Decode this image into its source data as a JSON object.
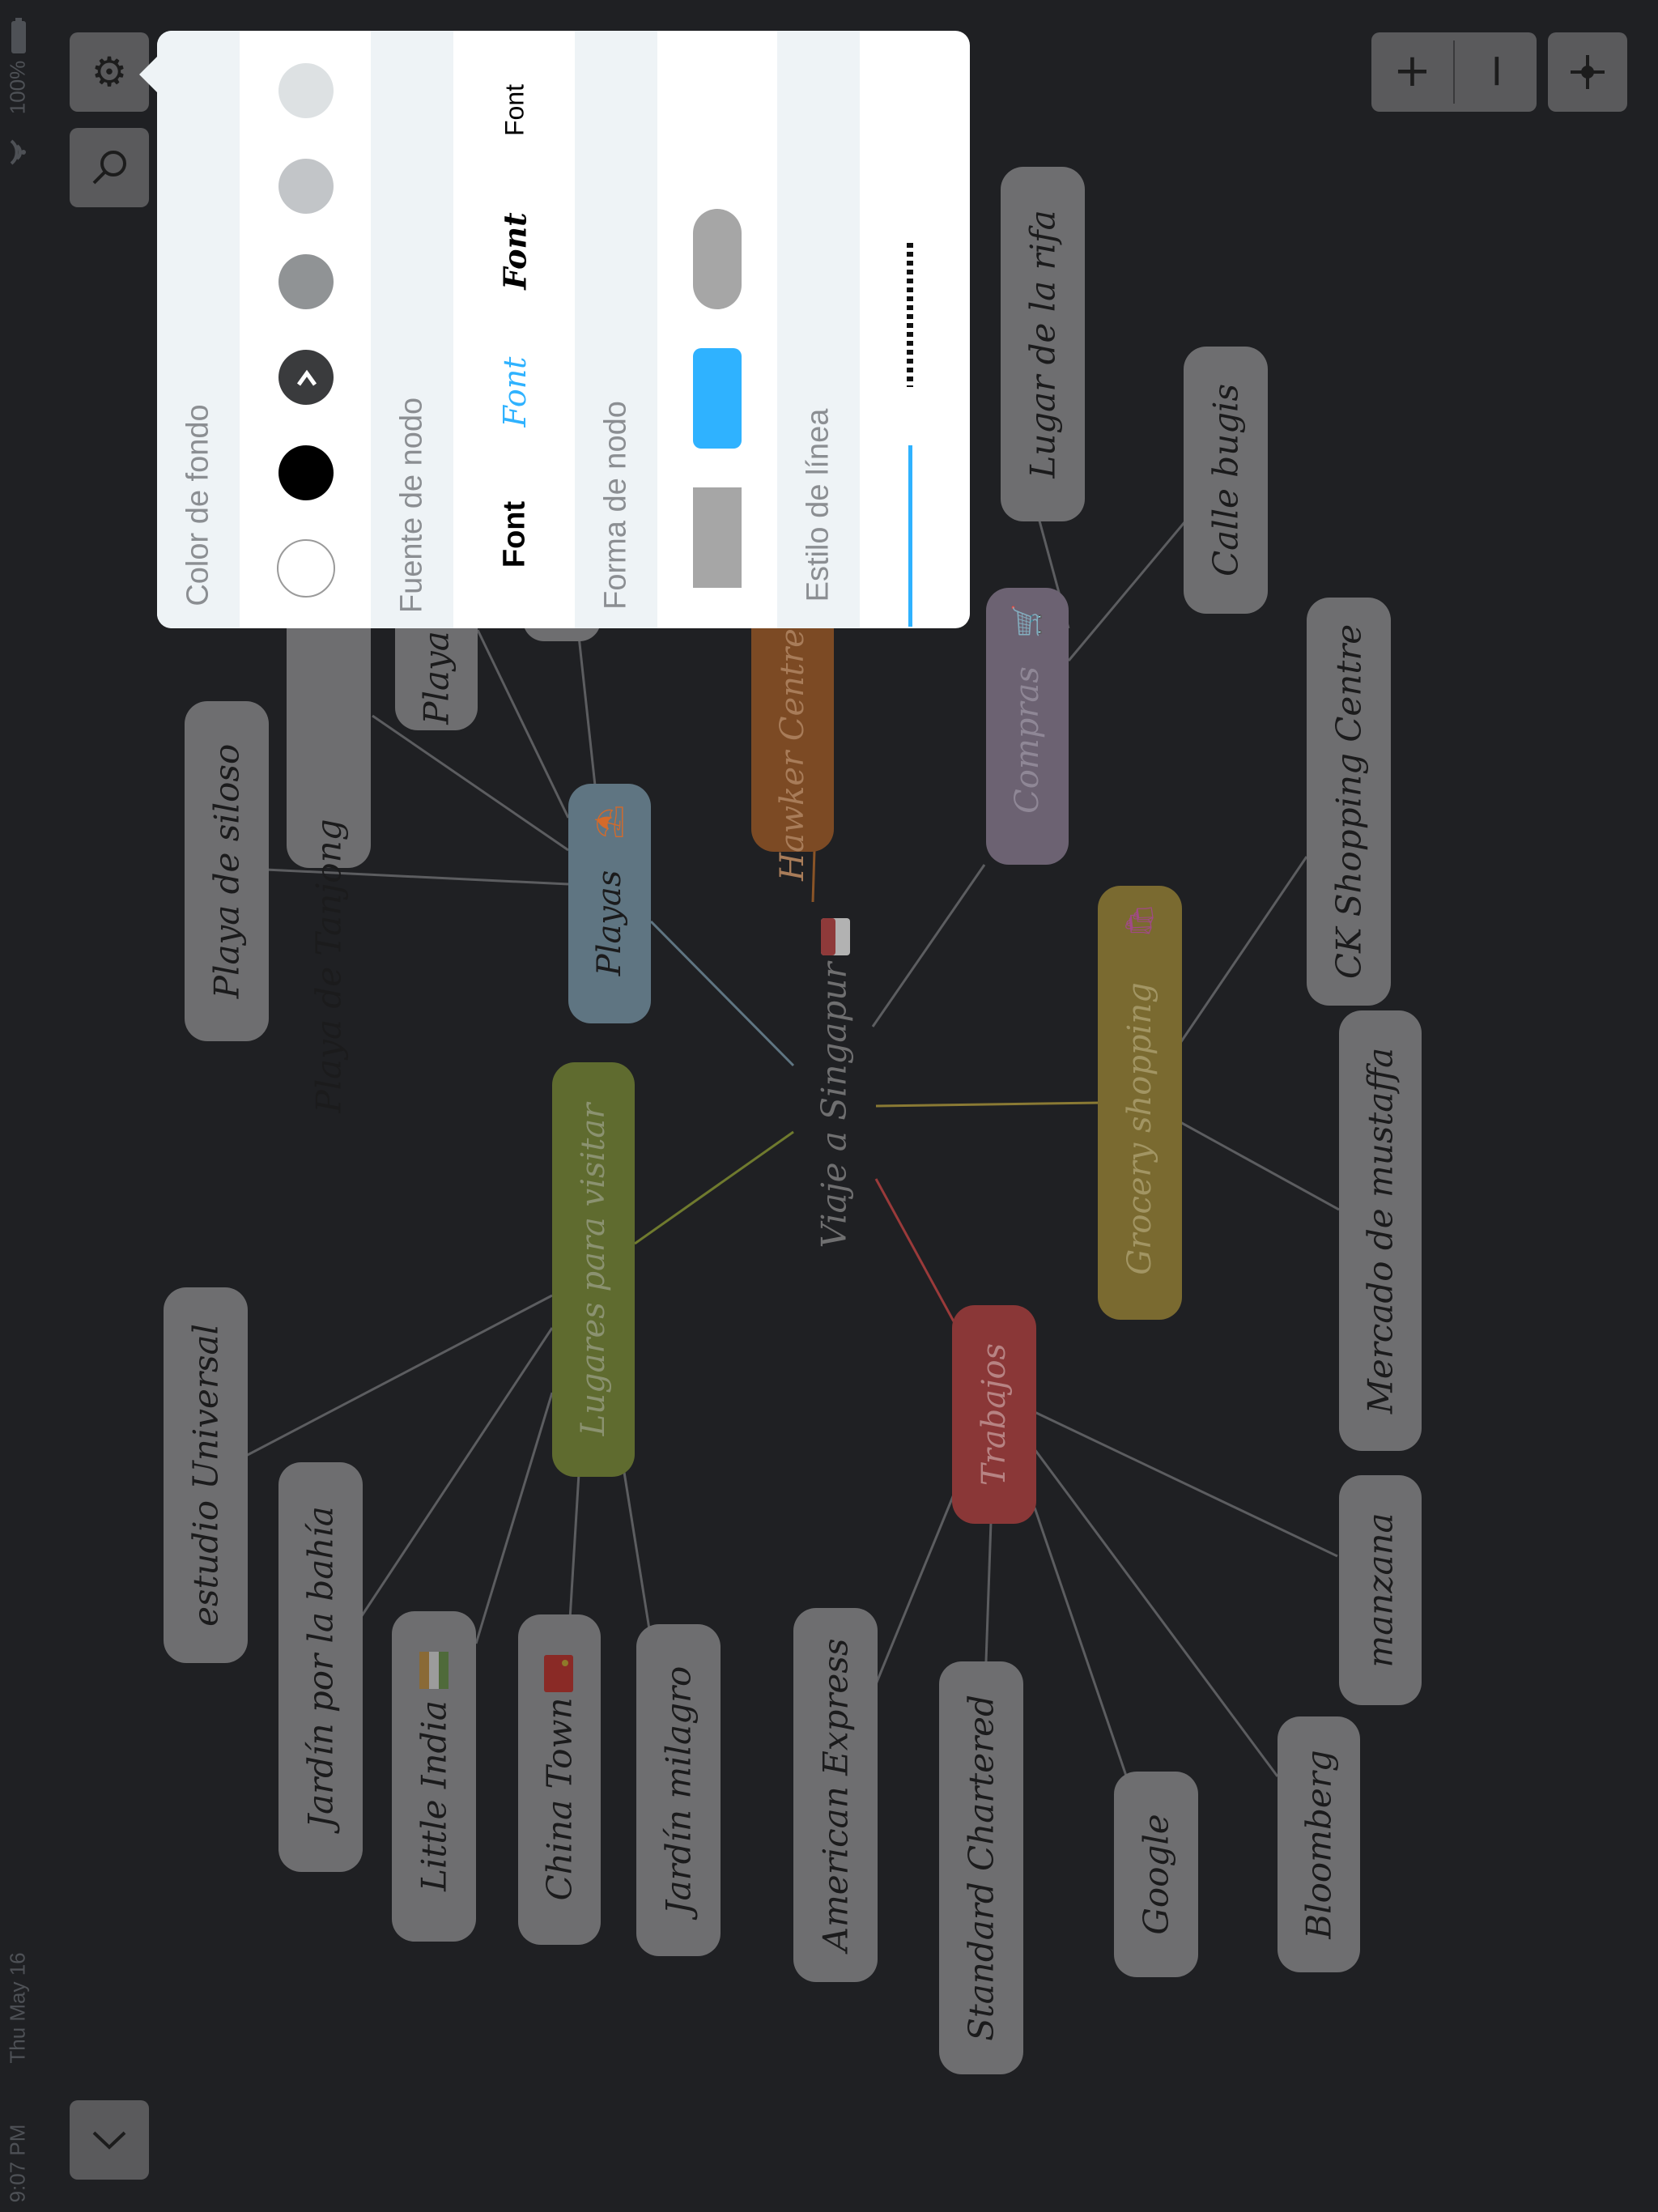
{
  "status_bar": {
    "time": "9:07 PM",
    "date": "Thu May 16",
    "battery": "100%",
    "wifi_icon": "wifi-icon",
    "battery_icon": "battery-icon"
  },
  "toolbar": {
    "settings_icon": "gear-icon",
    "search_icon": "search-icon",
    "zoom_in_label": "+",
    "zoom_out_label": "−",
    "center_icon": "crosshair-icon",
    "collapse_icon": "chevron-down-icon"
  },
  "settings_panel": {
    "background_color": {
      "title": "Color de fondo",
      "swatches": [
        "#ffffff",
        "#000000",
        "#3a3b3d",
        "#909395",
        "#c2c5c8",
        "#dde1e3"
      ],
      "selected_index": 2,
      "selected_icon": "chevron-right-icon"
    },
    "node_font": {
      "title": "Fuente de nodo",
      "options": [
        "Font",
        "Font",
        "Font",
        "Font"
      ],
      "selected_index": 1,
      "selected_color": "#2fb2ff"
    },
    "node_shape": {
      "title": "Forma de nodo",
      "options": [
        "square-shape",
        "rounded-shape",
        "pill-shape"
      ],
      "selected_index": 1,
      "selected_color": "#2fb2ff"
    },
    "line_style": {
      "title": "Estilo de línea",
      "options": [
        "solid-line",
        "dotted-line"
      ],
      "selected_index": 0
    }
  },
  "mindmap": {
    "center": {
      "label": "Viaje a Singapur",
      "icon": "singapore-flag-icon"
    },
    "categories": {
      "playas": "Playas",
      "lugares": "Lugares para visitar",
      "hawker": "Hawker Centre",
      "compras": "Compras",
      "grocery": "Grocery shopping",
      "trabajos": "Trabajos"
    },
    "playas_children": [
      "Playa de siloso",
      "Playa de Tanjong",
      "Playa"
    ],
    "lugares_children": [
      "estudio Universal",
      "Jardín por la bahía",
      "Little India",
      "China Town",
      "Jardín milagro"
    ],
    "compras_children": [
      "Lugar de la rifa",
      "Calle bugis"
    ],
    "grocery_children": [
      "CK Shopping Centre",
      "Mercado de mustaffa"
    ],
    "trabajos_children": [
      "American Express",
      "Standard Chartered",
      "Google",
      "Bloomberg",
      "manzana"
    ],
    "colors": {
      "playas": "#5f7582",
      "lugares": "#5f6b2f",
      "hawker": "#7c4a24",
      "compras": "#6c6272",
      "grocery": "#7a6a30",
      "trabajos": "#8a3737",
      "leaf": "#6e6e70"
    }
  }
}
